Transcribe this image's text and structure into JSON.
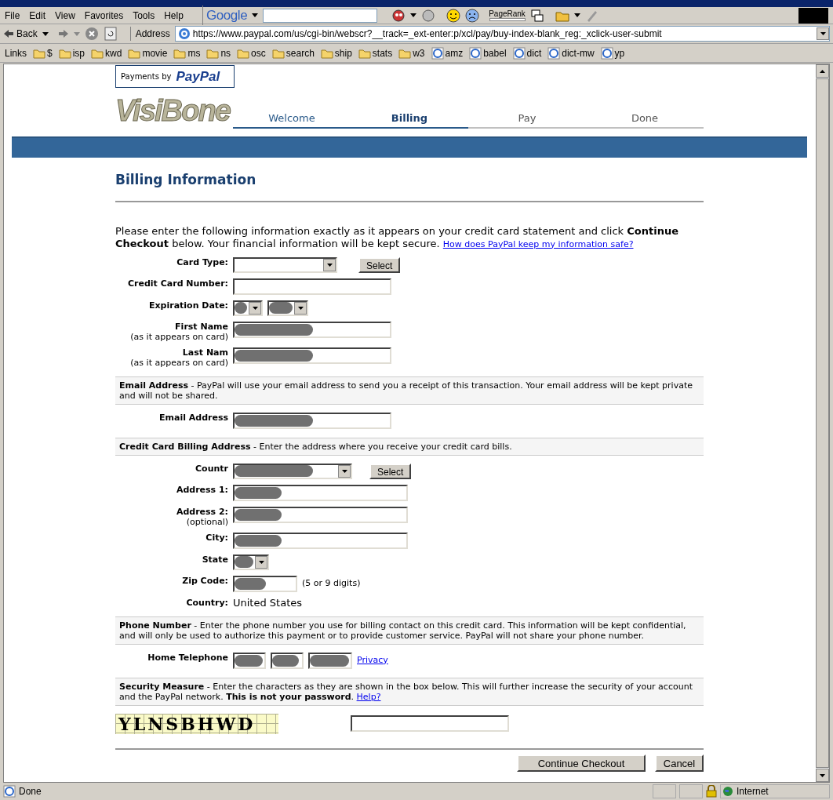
{
  "menu": [
    "File",
    "Edit",
    "View",
    "Favorites",
    "Tools",
    "Help"
  ],
  "google_toolbar": {
    "brand": "Google",
    "pagerank_label": "PageRank"
  },
  "address_bar": {
    "back": "Back",
    "label": "Address",
    "url": "https://www.paypal.com/us/cgi-bin/webscr?__track=_ext-enter:p/xcl/pay/buy-index-blank_reg:_xclick-user-submit"
  },
  "links_bar": {
    "label": "Links",
    "links": [
      {
        "label": "$",
        "kind": "folder"
      },
      {
        "label": "isp",
        "kind": "folder"
      },
      {
        "label": "kwd",
        "kind": "folder"
      },
      {
        "label": "movie",
        "kind": "folder"
      },
      {
        "label": "ms",
        "kind": "folder"
      },
      {
        "label": "ns",
        "kind": "folder"
      },
      {
        "label": "osc",
        "kind": "folder"
      },
      {
        "label": "search",
        "kind": "folder"
      },
      {
        "label": "ship",
        "kind": "folder"
      },
      {
        "label": "stats",
        "kind": "folder"
      },
      {
        "label": "w3",
        "kind": "folder"
      },
      {
        "label": "amz",
        "kind": "page"
      },
      {
        "label": "babel",
        "kind": "page"
      },
      {
        "label": "dict",
        "kind": "page"
      },
      {
        "label": "dict-mw",
        "kind": "page"
      },
      {
        "label": "yp",
        "kind": "page"
      }
    ]
  },
  "page": {
    "paypal_badge": {
      "prefix": "Payments by",
      "brand": "PayPal"
    },
    "logo": "VisiBone",
    "steps": [
      {
        "label": "Welcome",
        "selected": false,
        "completed": true
      },
      {
        "label": "Billing",
        "selected": true,
        "completed": false
      },
      {
        "label": "Pay",
        "selected": false,
        "completed": false
      },
      {
        "label": "Done",
        "selected": false,
        "completed": false
      }
    ],
    "heading": "Billing Information",
    "intro": "Please enter the following information exactly as it appears on your credit card statement and click **Continue Checkout** below. Your financial information will be kept secure.",
    "intro_link": "How does PayPal keep my information safe?",
    "sections": [
      {
        "fields": [
          {
            "label": "Card Type:",
            "kind": "select",
            "button": "Select",
            "redacted": false
          },
          {
            "label": "Credit Card Number:",
            "kind": "text",
            "redacted": false
          },
          {
            "label": "Expiration Date:",
            "kind": "date_pair",
            "redacted": true
          },
          {
            "label": "First Name",
            "sublabel": "(as it appears on card)",
            "kind": "text",
            "redacted": true
          },
          {
            "label": "Last Nam",
            "sublabel": "(as it appears on card)",
            "kind": "text",
            "redacted": true
          }
        ]
      },
      {
        "note": "**Email Address** - PayPal will use your email address to send you a receipt of this transaction. Your email address will be kept private and will not be shared.",
        "fields": [
          {
            "label": "Email Address",
            "kind": "text",
            "redacted": true
          }
        ]
      },
      {
        "note": "**Credit Card Billing Address** - Enter the address where you receive your credit card bills.",
        "fields": [
          {
            "label": "Countr",
            "kind": "select_wide",
            "button": "Select",
            "redacted": true
          },
          {
            "label": "Address 1:",
            "kind": "text_wide",
            "redacted": true
          },
          {
            "label": "Address 2:",
            "sublabel": "(optional)",
            "kind": "text_wide",
            "redacted": true
          },
          {
            "label": "City:",
            "kind": "text_wide",
            "redacted": true
          },
          {
            "label": "State",
            "kind": "select_small",
            "redacted": true
          },
          {
            "label": "Zip Code:",
            "kind": "text_short",
            "hint": "(5 or 9 digits)",
            "redacted": true
          },
          {
            "label": "Country:",
            "kind": "static",
            "value": "United States"
          }
        ]
      },
      {
        "note": "**Phone Number** - Enter the phone number you use for billing contact on this credit card. This information will be kept confidential, and will only be used to authorize this payment or to provide customer service. PayPal will not share your phone number.",
        "fields": [
          {
            "label": "Home Telephone",
            "kind": "phone",
            "link": "Privacy",
            "redacted": true
          }
        ]
      },
      {
        "note": "**Security Measure** - Enter the characters as they are shown in the box below. This will further increase the security of your account and the PayPal network. **This is not your password**.",
        "note_link": "Help?",
        "captcha": "YLNSBHWD"
      }
    ],
    "buttons": [
      "Continue Checkout",
      "Cancel"
    ]
  },
  "status_bar": {
    "text": "Done",
    "zone": "Internet"
  }
}
